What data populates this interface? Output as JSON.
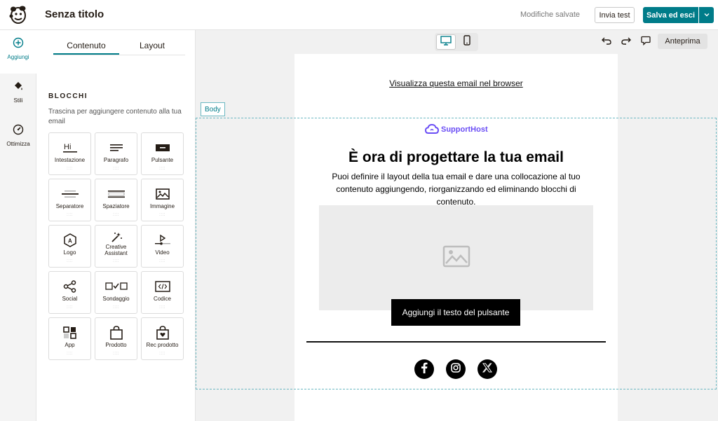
{
  "app": {
    "title": "Senza titolo",
    "saved_status": "Modifiche salvate",
    "send_test_label": "Invia test",
    "save_exit_label": "Salva ed esci"
  },
  "rail": {
    "items": [
      {
        "label": "Aggiungi",
        "icon": "plus-circle-icon"
      },
      {
        "label": "Stili",
        "icon": "paint-bucket-icon"
      },
      {
        "label": "Ottimizza",
        "icon": "gauge-icon"
      }
    ]
  },
  "panel": {
    "tabs": [
      "Contenuto",
      "Layout"
    ],
    "section_title": "BLOCCHI",
    "section_desc": "Trascina per aggiungere contenuto alla tua email",
    "blocks": [
      {
        "label": "Intestazione",
        "icon_text": "Hi"
      },
      {
        "label": "Paragrafo"
      },
      {
        "label": "Pulsante"
      },
      {
        "label": "Separatore"
      },
      {
        "label": "Spaziatore"
      },
      {
        "label": "Immagine"
      },
      {
        "label": "Logo",
        "icon_text": "A"
      },
      {
        "label": "Creative Assistant"
      },
      {
        "label": "Video"
      },
      {
        "label": "Social"
      },
      {
        "label": "Sondaggio"
      },
      {
        "label": "Codice"
      },
      {
        "label": "App"
      },
      {
        "label": "Prodotto"
      },
      {
        "label": "Rec prodotto"
      }
    ],
    "grip": "::::"
  },
  "toolbar": {
    "preview_label": "Anteprima"
  },
  "email": {
    "browser_link": "Visualizza questa email nel browser",
    "brand_name": "SupportHost",
    "headline": "È ora di progettare la tua email",
    "subtext": "Puoi definire il layout della tua email e dare una collocazione al tuo contenuto aggiungendo, riorganizzando ed eliminando blocchi di contenuto.",
    "button_label": "Aggiungi il testo del pulsante",
    "body_tag": "Body",
    "brand_color": "#6a4df5"
  },
  "colors": {
    "accent": "#007c89"
  }
}
